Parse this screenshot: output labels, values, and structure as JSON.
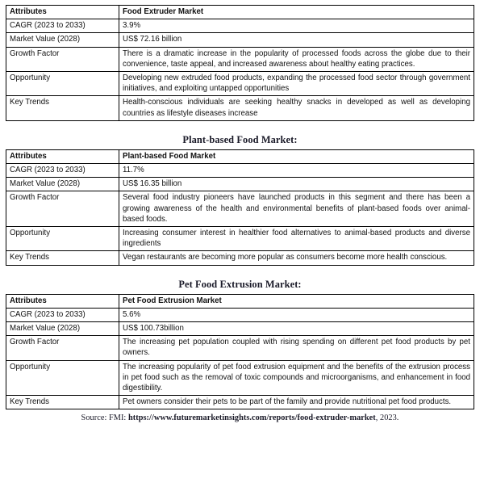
{
  "document": {
    "columns": [
      "Attributes",
      "Market"
    ],
    "tables": [
      {
        "title": "",
        "header": {
          "attribute_label": "Attributes",
          "market_label": "Food Extruder Market"
        },
        "rows": [
          {
            "attribute": "CAGR (2023 to 2033)",
            "value": "3.9%"
          },
          {
            "attribute": "Market Value (2028)",
            "value": "US$ 72.16 billion"
          },
          {
            "attribute": "Growth Factor",
            "value": "There is a dramatic increase in the popularity of processed foods across the globe due to their convenience, taste appeal, and increased awareness about healthy eating practices."
          },
          {
            "attribute": "Opportunity",
            "value": "Developing new extruded food products, expanding the processed food sector through government initiatives, and exploiting untapped opportunities"
          },
          {
            "attribute": "Key Trends",
            "value": "Health-conscious individuals are seeking healthy snacks in developed as well as developing countries as lifestyle diseases increase"
          }
        ]
      },
      {
        "title": "Plant-based Food Market:",
        "header": {
          "attribute_label": "Attributes",
          "market_label": "Plant-based Food Market"
        },
        "rows": [
          {
            "attribute": "CAGR (2023 to 2033)",
            "value": "11.7%"
          },
          {
            "attribute": "Market Value (2028)",
            "value": "US$ 16.35 billion"
          },
          {
            "attribute": "Growth Factor",
            "value": "Several food industry pioneers have launched products in this segment and there has been a growing awareness of the health and environmental benefits of plant-based foods over animal-based foods."
          },
          {
            "attribute": "Opportunity",
            "value": "Increasing consumer interest in healthier food alternatives to animal-based products and diverse ingredients"
          },
          {
            "attribute": "Key Trends",
            "value": "Vegan restaurants are becoming more popular as consumers become more health conscious."
          }
        ]
      },
      {
        "title": "Pet Food Extrusion Market:",
        "header": {
          "attribute_label": "Attributes",
          "market_label": "Pet Food Extrusion Market"
        },
        "rows": [
          {
            "attribute": "CAGR (2023 to 2033)",
            "value": "5.6%"
          },
          {
            "attribute": "Market Value (2028)",
            "value": "US$ 100.73billion"
          },
          {
            "attribute": "Growth Factor",
            "value": "The increasing pet population coupled with rising spending on different pet food products by pet owners."
          },
          {
            "attribute": "Opportunity",
            "value": "The increasing popularity of pet food extrusion equipment and the benefits of the extrusion process in pet food such as the removal of toxic compounds and microorganisms, and enhancement in food digestibility."
          },
          {
            "attribute": "Key Trends",
            "value": "Pet owners consider their pets to be part of the family and provide nutritional pet food products."
          }
        ]
      }
    ],
    "source": {
      "prefix": "Source: FMI: ",
      "url": "https://www.futuremarketinsights.com/reports/food-extruder-market",
      "suffix": ", 2023."
    }
  }
}
